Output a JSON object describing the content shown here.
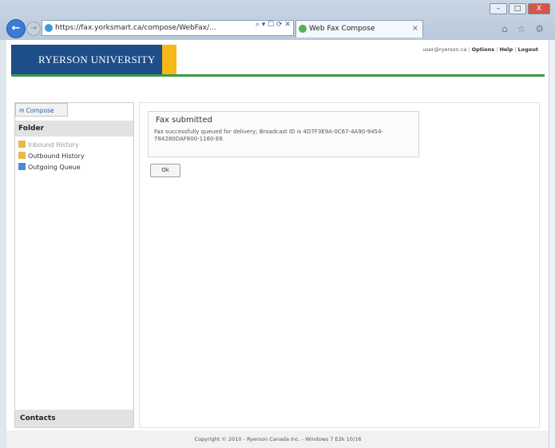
{
  "browser": {
    "address": "https://fax.yorksmart.ca/compose/WebFax/...",
    "address_tools": "⌕ ▾ ☐ ⟳ ✕",
    "tab_title": "Web Fax Compose",
    "tab_close": "×",
    "icons": "⌂ ☆ ⚙",
    "win_min": "–",
    "win_max": "□",
    "win_close": "X",
    "back": "←",
    "forward": "→"
  },
  "header": {
    "logo_text": "RYERSON UNIVERSITY",
    "accent_color": "#f6b817",
    "brand_color": "#1d4e89",
    "user": "user@ryerson.ca",
    "links": [
      "Options",
      "Help",
      "Logout"
    ]
  },
  "sidebar": {
    "compose_label": "Compose",
    "folder_heading": "Folder",
    "items": [
      {
        "label": "Inbound History",
        "icon": "inbound-history-icon"
      },
      {
        "label": "Outbound History",
        "icon": "outbound-history-icon"
      },
      {
        "label": "Outgoing Queue",
        "icon": "outgoing-queue-icon"
      }
    ],
    "contacts_heading": "Contacts"
  },
  "main": {
    "fax_title": "Fax submitted",
    "fax_message": "Fax successfully queued for delivery; Broadcast ID is 4D7F3E9A-0C67-4A90-9454-784280DAF800-1160-E6",
    "ok_label": "Ok"
  },
  "footer": {
    "copyright": "Copyright © 2010 - Ryerson Canada Inc. - Windows 7 E2k 10/16"
  }
}
